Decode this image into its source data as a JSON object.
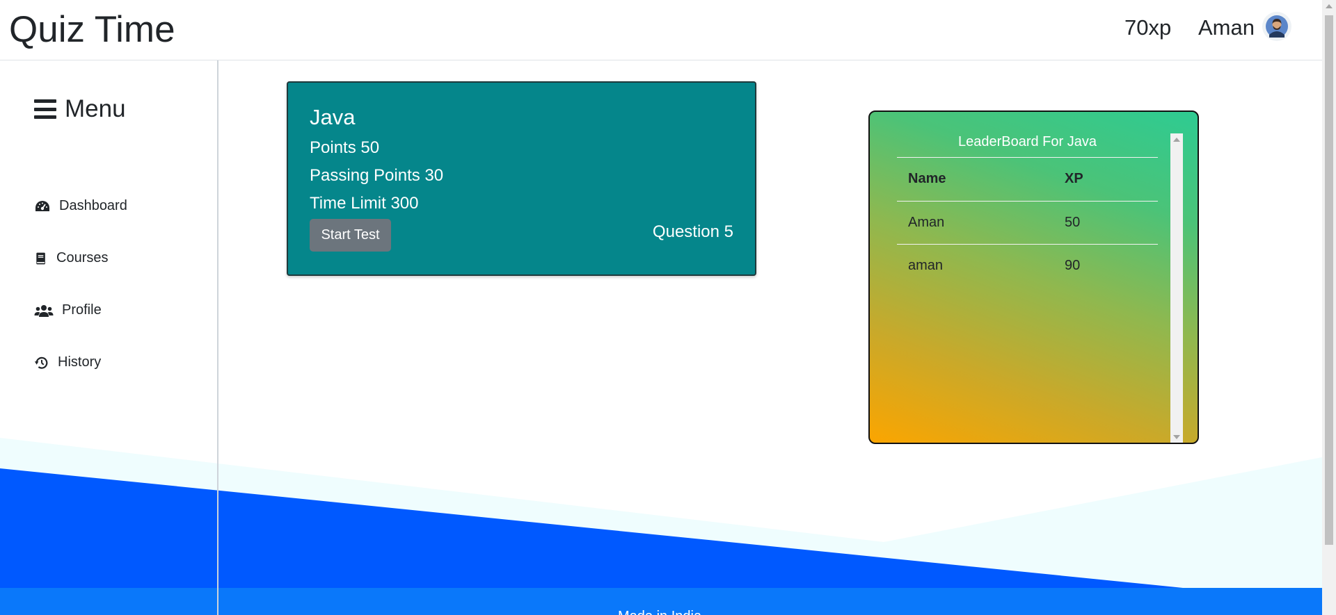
{
  "header": {
    "title": "Quiz Time",
    "xp": "70xp",
    "username": "Aman"
  },
  "sidebar": {
    "menu_label": "Menu",
    "items": [
      {
        "label": "Dashboard",
        "icon": "dashboard-icon"
      },
      {
        "label": "Courses",
        "icon": "book-icon"
      },
      {
        "label": "Profile",
        "icon": "users-icon"
      },
      {
        "label": "History",
        "icon": "history-icon"
      }
    ]
  },
  "quiz": {
    "subject": "Java",
    "points": "Points 50",
    "passing_points": "Passing Points 30",
    "time_limit": "Time Limit 300",
    "start_label": "Start Test",
    "question_count": "Question 5"
  },
  "leaderboard": {
    "title": "LeaderBoard For Java",
    "columns": [
      "Name",
      "XP"
    ],
    "rows": [
      {
        "name": "Aman",
        "xp": "50"
      },
      {
        "name": "aman",
        "xp": "90"
      }
    ]
  },
  "footer": {
    "text": "Made in India"
  },
  "colors": {
    "card": "#05868b",
    "footer": "#0a78fa",
    "wave_blue": "#0059ff",
    "wave_light": "#effdfe",
    "leaderboard_top": "#2ecb92",
    "leaderboard_bottom": "#fba500"
  }
}
